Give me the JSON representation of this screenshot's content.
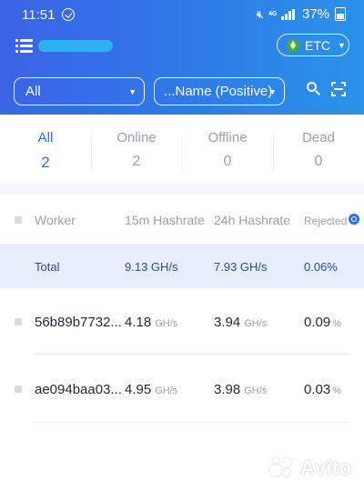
{
  "status_bar": {
    "time": "11:51",
    "network": "4G",
    "battery": "37%",
    "icons": [
      "check-circle-icon",
      "mute-icon",
      "signal-icon",
      "battery-icon"
    ]
  },
  "header": {
    "menu_icon": "menu-icon",
    "coin": {
      "label": "ETC",
      "icon": "ethereum-classic-icon"
    },
    "filters": {
      "status": "All",
      "sort": "...Name (Positive)"
    },
    "icons": [
      "search-icon",
      "scan-icon"
    ]
  },
  "tabs": [
    {
      "label": "All",
      "count": "2",
      "active": true
    },
    {
      "label": "Online",
      "count": "2",
      "active": false
    },
    {
      "label": "Offline",
      "count": "0",
      "active": false
    },
    {
      "label": "Dead",
      "count": "0",
      "active": false
    }
  ],
  "table": {
    "headers": {
      "worker": "Worker",
      "hashrate_15m": "15m Hashrate",
      "hashrate_24h": "24h Hashrate",
      "rejected": "Rejected"
    },
    "total": {
      "label": "Total",
      "hashrate_15m": "9.13 GH/s",
      "hashrate_24h": "7.93 GH/s",
      "rejected": "0.06%"
    },
    "rows": [
      {
        "worker": "56b89b7732...",
        "h15": "4.18",
        "h15_unit": "GH/s",
        "h24": "3.94",
        "h24_unit": "GH/s",
        "rej": "0.09",
        "rej_unit": "%"
      },
      {
        "worker": "ae094baa03...",
        "h15": "4.95",
        "h15_unit": "GH/s",
        "h24": "3.98",
        "h24_unit": "GH/s",
        "rej": "0.03",
        "rej_unit": "%"
      }
    ]
  },
  "watermark": "Avito",
  "colors": {
    "header_gradient_start": "#3b63e6",
    "header_gradient_end": "#2a93ea",
    "accent": "#2f6fe0",
    "total_row_bg": "#e9eefc"
  }
}
